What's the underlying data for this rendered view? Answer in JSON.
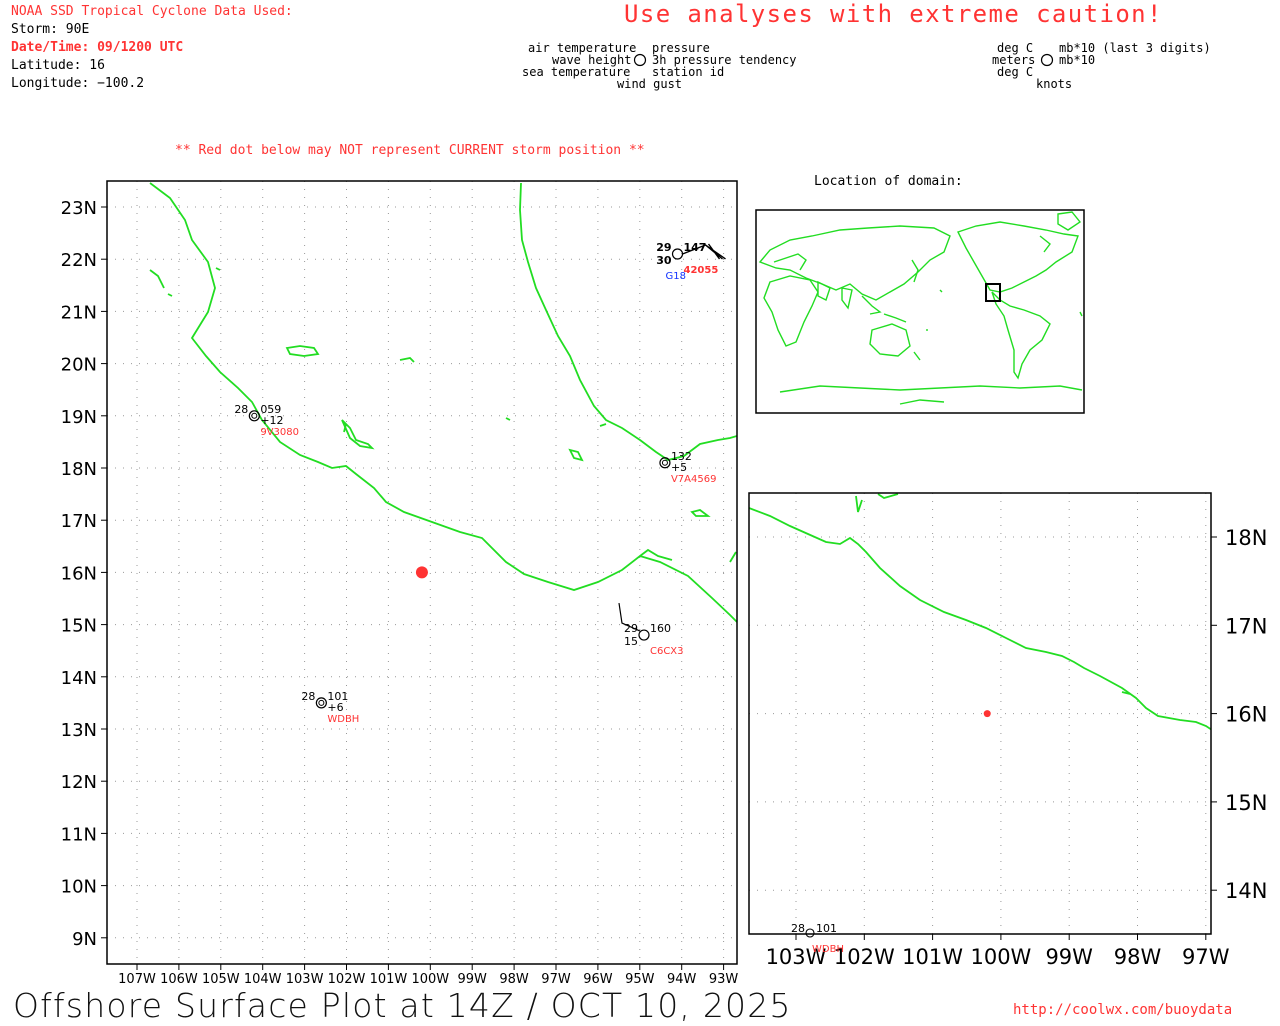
{
  "header": {
    "source_title": "NOAA SSD Tropical Cyclone Data Used:",
    "storm": "Storm: 90E",
    "datetime": "Date/Time: 09/1200 UTC",
    "latitude": "Latitude: 16",
    "longitude": "Longitude: −100.2",
    "caution": "Use analyses with extreme caution!",
    "red_dot_warning": "** Red dot below may NOT represent CURRENT storm position **"
  },
  "legend": {
    "left_labels": [
      "air temperature",
      "wave height",
      "sea temperature"
    ],
    "right_labels": [
      "pressure",
      "3h pressure tendency",
      "station id"
    ],
    "bottom_label": "wind gust",
    "unit_left": [
      "deg C",
      "meters",
      "deg C"
    ],
    "unit_right": [
      "mb*10 (last 3 digits)",
      "mb*10"
    ],
    "unit_bottom": "knots"
  },
  "inset": {
    "title": "Location of domain:"
  },
  "main_map": {
    "lat_labels": [
      "23N",
      "22N",
      "21N",
      "20N",
      "19N",
      "18N",
      "17N",
      "16N",
      "15N",
      "14N",
      "13N",
      "12N",
      "11N",
      "10N",
      "9N"
    ],
    "lon_labels": [
      "107W",
      "106W",
      "105W",
      "104W",
      "103W",
      "102W",
      "101W",
      "100W",
      "99W",
      "98W",
      "97W",
      "96W",
      "95W",
      "94W",
      "93W"
    ],
    "storm_position": {
      "lat": 16,
      "lon": -100.2
    },
    "stations": [
      {
        "id": "42055",
        "lat": 22.1,
        "lon": -94.1,
        "air_temp": "29",
        "sea_temp": "30",
        "pressure": "147",
        "extra": "G18"
      },
      {
        "id": "9V3080",
        "lat": 19.0,
        "lon": -104.2,
        "air_temp": "28",
        "pressure": "059",
        "tendency": "+12"
      },
      {
        "id": "V7A4569",
        "lat": 18.1,
        "lon": -94.4,
        "pressure": "132",
        "tendency": "+5"
      },
      {
        "id": "C6CX3",
        "lat": 14.8,
        "lon": -94.9,
        "air_temp": "29",
        "sea_temp": "15",
        "pressure": "160"
      },
      {
        "id": "WDBH",
        "lat": 13.5,
        "lon": -102.6,
        "air_temp": "28",
        "pressure": "101",
        "tendency": "+6"
      }
    ]
  },
  "zoom_map": {
    "lat_labels": [
      "18N",
      "17N",
      "16N",
      "15N",
      "14N"
    ],
    "lon_labels": [
      "103W",
      "102W",
      "101W",
      "100W",
      "99W",
      "98W",
      "97W"
    ],
    "station_id": "WDBH",
    "station_air_temp": "28",
    "station_pressure": "101"
  },
  "footer": {
    "title": "Offshore Surface Plot at 14Z / OCT 10, 2025",
    "url": "http://coolwx.com/buoydata"
  },
  "colors": {
    "coast": "#22dd22",
    "accent": "#ff3333",
    "gust": "#1133ff"
  }
}
